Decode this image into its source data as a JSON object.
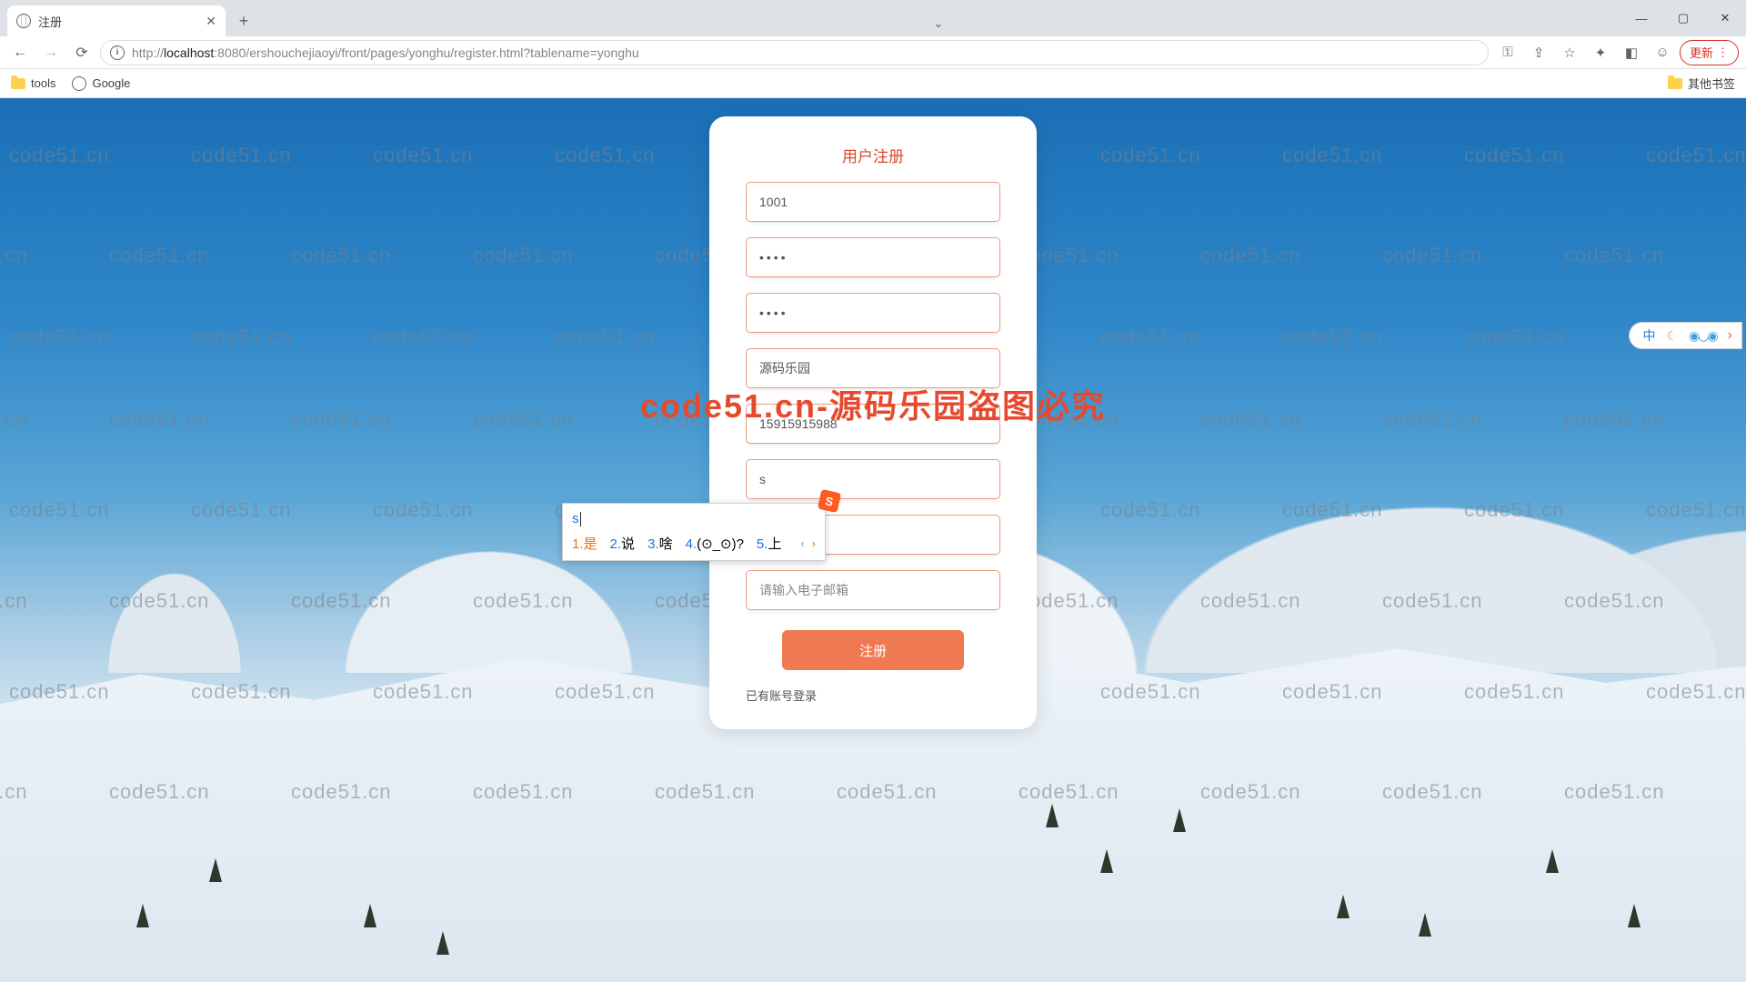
{
  "browser": {
    "tab_title": "注册",
    "url_scheme": "http://",
    "url_host": "localhost",
    "url_port_path": ":8080/ershouchejiaoyi/front/pages/yonghu/register.html?tablename=yonghu",
    "update_label": "更新",
    "bookmarks": {
      "tools": "tools",
      "google": "Google",
      "other": "其他书签"
    }
  },
  "watermark": {
    "text": "code51.cn",
    "banner": "code51.cn-源码乐园盗图必究"
  },
  "form": {
    "title": "用户注册",
    "username": "1001",
    "password": "••••",
    "password2": "••••",
    "nickname": "源码乐园",
    "phone": "15915915988",
    "addr_value": "s",
    "id_value": "",
    "email_placeholder": "请输入电子邮箱",
    "submit": "注册",
    "login_link": "已有账号登录"
  },
  "ime": {
    "typed": "s",
    "candidates": [
      {
        "n": "1.",
        "w": "是"
      },
      {
        "n": "2.",
        "w": "说"
      },
      {
        "n": "3.",
        "w": "啥"
      },
      {
        "n": "4.",
        "w": "(⊙_⊙)?"
      },
      {
        "n": "5.",
        "w": "上"
      }
    ],
    "logo": "S",
    "toolbar_zh": "中"
  }
}
